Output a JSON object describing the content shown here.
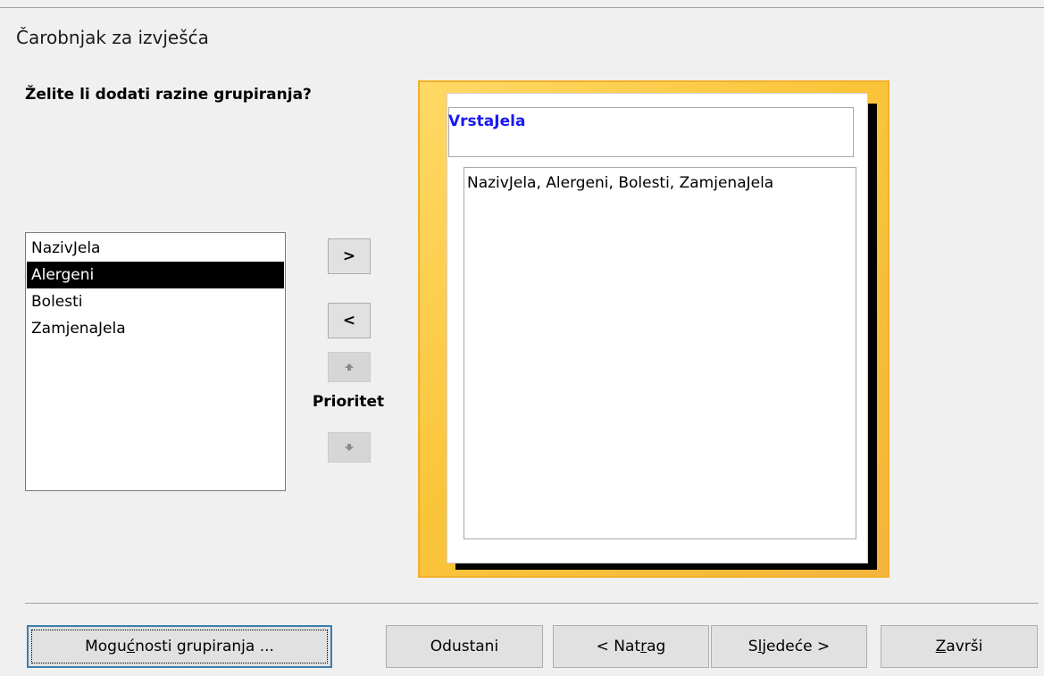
{
  "window": {
    "title": "Čarobnjak za izvješća"
  },
  "question": "Želite li dodati razine grupiranja?",
  "field_list": {
    "items": [
      {
        "label": "NazivJela",
        "selected": false
      },
      {
        "label": "Alergeni",
        "selected": true
      },
      {
        "label": "Bolesti",
        "selected": false
      },
      {
        "label": "ZamjenaJela",
        "selected": false
      }
    ]
  },
  "arrow_buttons": {
    "add": ">",
    "remove": "<",
    "priority_up_icon": "up-arrow-icon",
    "priority_down_icon": "down-arrow-icon",
    "priority_label": "Prioritet"
  },
  "preview": {
    "group_field": "VrstaJela",
    "detail_fields": "NazivJela, Alergeni, Bolesti, ZamjenaJela"
  },
  "buttons": {
    "grouping_options": {
      "pre": "Mogu",
      "key": "ć",
      "post": "nosti grupiranja ..."
    },
    "cancel": {
      "label": "Odustani"
    },
    "back": {
      "pre": "< Nat",
      "key": "r",
      "post": "ag"
    },
    "next": {
      "pre": "S",
      "key": "l",
      "post": "jedeće >"
    },
    "finish": {
      "pre": "",
      "key": "Z",
      "post": "avrši"
    }
  },
  "colors": {
    "accent_gold": "#f4b53a",
    "group_label_blue": "#1a1aee",
    "selection": "#000000"
  }
}
